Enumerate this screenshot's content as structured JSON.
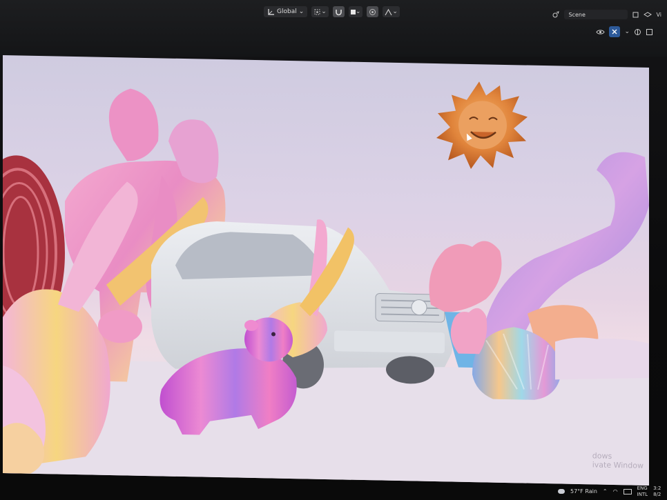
{
  "toolbar": {
    "transform_orientation": "Global",
    "scene_label": "Scene",
    "view_layer_label": "Vi"
  },
  "icons": {
    "orientation": "transform-orientation-icon",
    "pivot": "pivot-point-icon",
    "snap": "snap-magnet-icon",
    "proportional": "proportional-editing-icon",
    "falloff": "falloff-curve-icon"
  },
  "viewport": {
    "watermark_line1": "dows",
    "watermark_line2": "ivate Window"
  },
  "taskbar": {
    "weather": "57°F Rain",
    "lang_top": "ENG",
    "lang_bottom": "INTL",
    "time_top": "3:2",
    "time_bottom": "8/2"
  }
}
